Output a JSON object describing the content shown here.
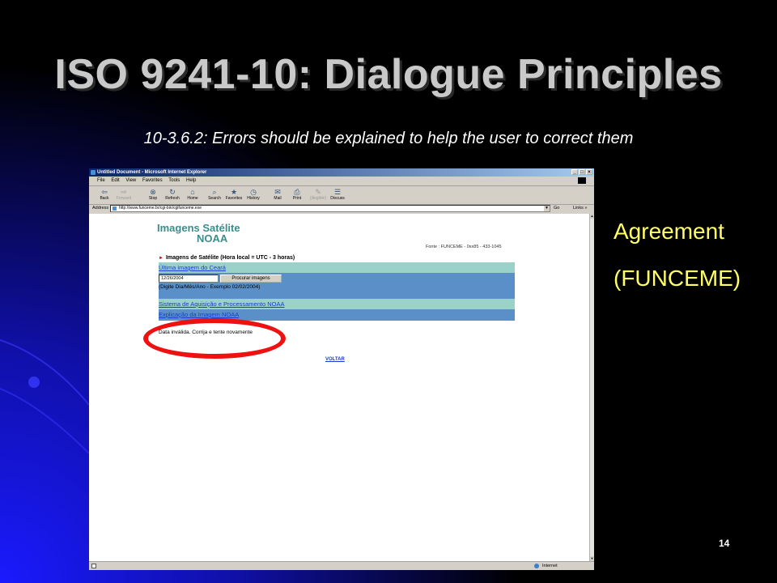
{
  "slide": {
    "title": "ISO 9241-10: Dialogue Principles",
    "subtitle": "10-3.6.2: Errors should be explained to help the user to correct them",
    "side_line1": "Agreement",
    "side_line2": "(FUNCEME)",
    "slide_number": "14"
  },
  "browser": {
    "window_title": "Untitled Document - Microsoft Internet Explorer",
    "menu": [
      "File",
      "Edit",
      "View",
      "Favorites",
      "Tools",
      "Help"
    ],
    "toolbar": [
      {
        "label": "Back",
        "icon": "back-arrow-icon",
        "glyph": "⇦",
        "enabled": true
      },
      {
        "label": "Forward",
        "icon": "forward-arrow-icon",
        "glyph": "⇨",
        "enabled": false
      },
      {
        "label": "Stop",
        "icon": "stop-icon",
        "glyph": "⊗",
        "enabled": true
      },
      {
        "label": "Refresh",
        "icon": "refresh-icon",
        "glyph": "↻",
        "enabled": true
      },
      {
        "label": "Home",
        "icon": "home-icon",
        "glyph": "⌂",
        "enabled": true
      },
      {
        "label": "Search",
        "icon": "search-icon",
        "glyph": "⌕",
        "enabled": true
      },
      {
        "label": "Favorites",
        "icon": "favorites-icon",
        "glyph": "★",
        "enabled": true
      },
      {
        "label": "History",
        "icon": "history-icon",
        "glyph": "◷",
        "enabled": true
      },
      {
        "label": "Mail",
        "icon": "mail-icon",
        "glyph": "✉",
        "enabled": true
      },
      {
        "label": "Print",
        "icon": "print-icon",
        "glyph": "⎙",
        "enabled": true
      },
      {
        "label": "[illegible]",
        "icon": "edit-icon",
        "glyph": "✎",
        "enabled": false
      },
      {
        "label": "Discuss",
        "icon": "discuss-icon",
        "glyph": "☰",
        "enabled": true
      }
    ],
    "address_label": "Address",
    "address_url": "http://www.funceme.br/cgi-bin/cgifunceme.exe",
    "go_label": "Go",
    "links_label": "Links »",
    "status_zone": "Internet"
  },
  "page": {
    "title_line1": "Imagens Satélite",
    "title_line2": "NOAA",
    "fonte": "Fonte : FUNCEME - 0xx85 - 433-1045",
    "section_heading": "Imagens de Satélite (Hora local = UTC - 3 horas)",
    "link_ultima": "Última imagem do Ceará",
    "date_value": "12/26/2004",
    "search_button": "Procurar imagens",
    "date_hint": "(Digite Dia/Mês/Ano - Exemplo 02/02/2004)",
    "link_sistema": "Sistema de Aquisição e Processamento NOAA",
    "link_explicacao": "Explicação da Imagem NOAA",
    "error_message": "Data inválida. Corrija e tente novamente",
    "voltar": "VOLTAR"
  },
  "colors": {
    "title_gray": "#c9c9c9",
    "side_yellow": "#ffff66",
    "teal_row": "#9ad1c8",
    "blue_row": "#5b8fc8",
    "highlight_red": "#ee1111",
    "page_title_teal": "#3a8d8a"
  }
}
